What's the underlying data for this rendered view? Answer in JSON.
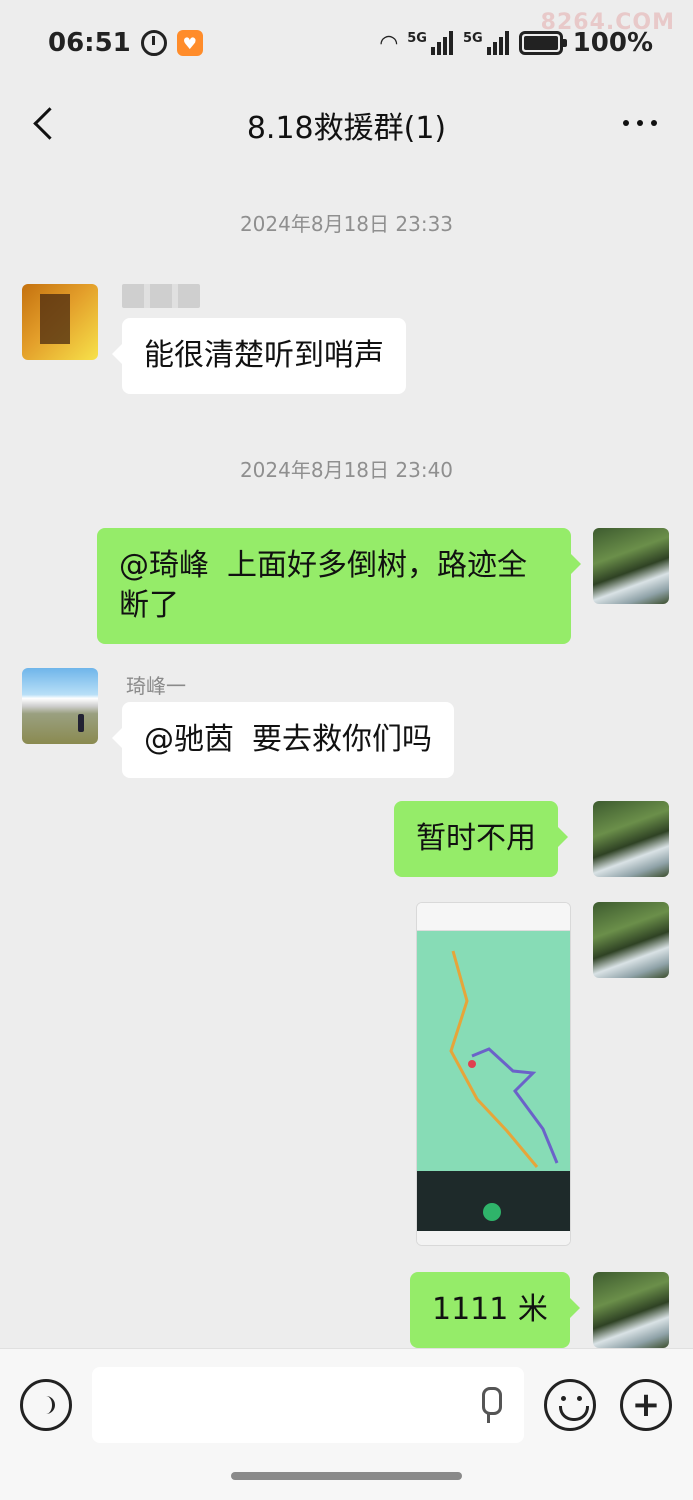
{
  "status_bar": {
    "time": "06:51",
    "network_1": "5G",
    "network_2": "5G",
    "battery": "100%",
    "watermark": "8264.COM"
  },
  "header": {
    "title": "8.18救援群(1)"
  },
  "messages": [
    {
      "type": "timestamp",
      "text": "2024年8月18日 23:33"
    },
    {
      "type": "incoming",
      "sender": "",
      "text": "能很清楚听到哨声"
    },
    {
      "type": "timestamp",
      "text": "2024年8月18日 23:40"
    },
    {
      "type": "outgoing",
      "mention": "@琦峰",
      "text": "上面好多倒树，路迹全断了"
    },
    {
      "type": "incoming",
      "sender": "琦峰一",
      "mention": "@驰茵",
      "text": "要去救你们吗"
    },
    {
      "type": "outgoing",
      "text": "暂时不用"
    },
    {
      "type": "outgoing-image",
      "icon": "map-track-screenshot"
    },
    {
      "type": "outgoing",
      "text": "1111 米"
    }
  ],
  "input_bar": {
    "placeholder": ""
  },
  "colors": {
    "background": "#ededed",
    "bubble_out": "#95ec69",
    "bubble_in": "#ffffff"
  }
}
